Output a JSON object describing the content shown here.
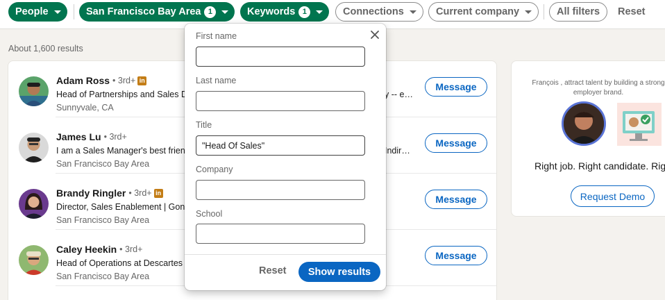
{
  "filters": {
    "people": "People",
    "location": "San Francisco Bay Area",
    "location_count": "1",
    "keywords": "Keywords",
    "keywords_count": "1",
    "connections": "Connections",
    "current_company": "Current company",
    "all_filters": "All filters",
    "reset": "Reset"
  },
  "results_count": "About 1,600 results",
  "results": [
    {
      "name": "Adam Ross",
      "degree": "• 3rd+",
      "headline": "Head of Partnerships and Sales D",
      "headline_tail": "y -- e…",
      "location": "Sunnyvale, CA",
      "action": "Message"
    },
    {
      "name": "James Lu",
      "degree": "• 3rd+",
      "headline": "I am a Sales Manager's best frien",
      "headline_tail": "Indir…",
      "location": "San Francisco Bay Area",
      "action": "Message"
    },
    {
      "name": "Brandy Ringler",
      "degree": "• 3rd+",
      "headline": "Director, Sales Enablement | Gon",
      "headline_tail": "",
      "location": "San Francisco Bay Area",
      "action": "Message"
    },
    {
      "name": "Caley Heekin",
      "degree": "• 3rd+",
      "headline": "Head of Operations at Descartes",
      "headline_tail": "",
      "location": "San Francisco Bay Area",
      "action": "Message"
    }
  ],
  "ad": {
    "text": "François , attract talent by building a strong employer brand.",
    "tagline": "Right job. Right candidate. Right",
    "button": "Request Demo"
  },
  "keyword_form": {
    "first_name_label": "First name",
    "first_name_value": "",
    "last_name_label": "Last name",
    "last_name_value": "",
    "title_label": "Title",
    "title_value": "\"Head Of Sales\"",
    "company_label": "Company",
    "company_value": "",
    "school_label": "School",
    "school_value": "",
    "reset": "Reset",
    "show_results": "Show results"
  },
  "colors": {
    "active_pill": "#01754f",
    "primary": "#0a66c2",
    "background": "#f4f2ee"
  }
}
